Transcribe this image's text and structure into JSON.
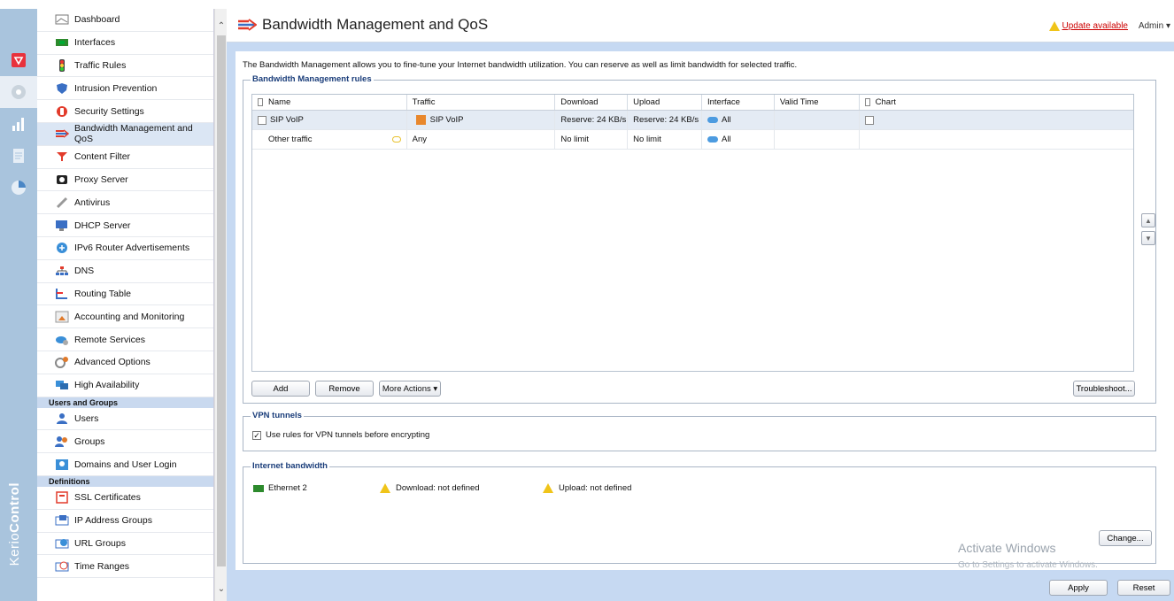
{
  "header": {
    "title": "Bandwidth Management and QoS",
    "update_label": "Update available",
    "admin_label": "Admin"
  },
  "brand": {
    "name_light": "Kerio",
    "name_bold": "Control"
  },
  "nav": {
    "items": [
      {
        "label": "Dashboard"
      },
      {
        "label": "Interfaces"
      },
      {
        "label": "Traffic Rules"
      },
      {
        "label": "Intrusion Prevention"
      },
      {
        "label": "Security Settings"
      },
      {
        "label": "Bandwidth Management and QoS"
      },
      {
        "label": "Content Filter"
      },
      {
        "label": "Proxy Server"
      },
      {
        "label": "Antivirus"
      },
      {
        "label": "DHCP Server"
      },
      {
        "label": "IPv6 Router Advertisements"
      },
      {
        "label": "DNS"
      },
      {
        "label": "Routing Table"
      },
      {
        "label": "Accounting and Monitoring"
      },
      {
        "label": "Remote Services"
      },
      {
        "label": "Advanced Options"
      },
      {
        "label": "High Availability"
      }
    ],
    "section_users": "Users and Groups",
    "users_items": [
      {
        "label": "Users"
      },
      {
        "label": "Groups"
      },
      {
        "label": "Domains and User Login"
      }
    ],
    "section_definitions": "Definitions",
    "definition_items": [
      {
        "label": "SSL Certificates"
      },
      {
        "label": "IP Address Groups"
      },
      {
        "label": "URL Groups"
      },
      {
        "label": "Time Ranges"
      }
    ]
  },
  "main": {
    "description": "The Bandwidth Management allows you to fine-tune your Internet bandwidth utilization. You can reserve as well as limit bandwidth for selected traffic.",
    "rules_legend": "Bandwidth Management rules",
    "columns": {
      "name": "Name",
      "traffic": "Traffic",
      "download": "Download",
      "upload": "Upload",
      "interface": "Interface",
      "valid_time": "Valid Time",
      "chart": "Chart"
    },
    "rows": [
      {
        "name": "SIP VoIP",
        "traffic": "SIP VoIP",
        "download": "Reserve: 24 KB/s",
        "upload": "Reserve: 24 KB/s",
        "interface": "All"
      },
      {
        "name": "Other traffic",
        "traffic": "Any",
        "download": "No limit",
        "upload": "No limit",
        "interface": "All"
      }
    ],
    "buttons": {
      "add": "Add",
      "remove": "Remove",
      "more_actions": "More Actions",
      "troubleshoot": "Troubleshoot...",
      "change": "Change...",
      "apply": "Apply",
      "reset": "Reset"
    },
    "vpn_legend": "VPN tunnels",
    "vpn_checkbox_label": "Use rules for VPN tunnels before encrypting",
    "internet_legend": "Internet bandwidth",
    "internet": {
      "interface": "Ethernet 2",
      "download": "Download: not defined",
      "upload": "Upload: not defined"
    }
  },
  "watermark": {
    "title": "Activate Windows",
    "subtitle": "Go to Settings to activate Windows."
  }
}
